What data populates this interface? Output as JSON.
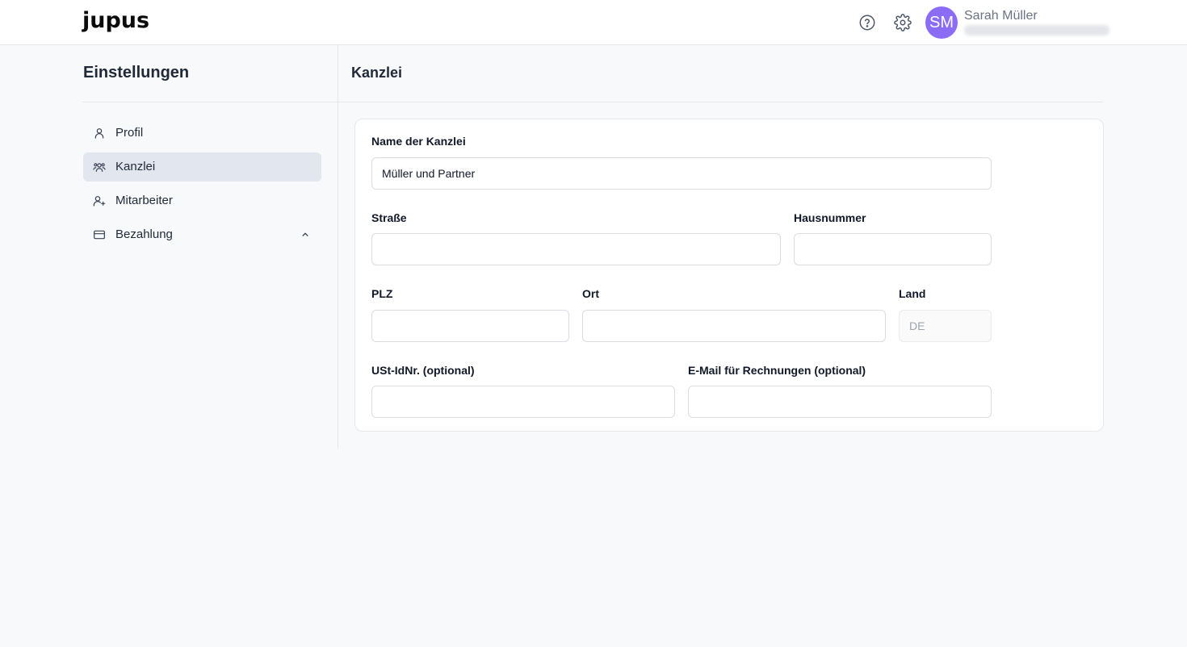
{
  "header": {
    "logo": "jupus",
    "user": {
      "initials": "SM",
      "name": "Sarah Müller",
      "avatar_color": "#8b6cf6"
    },
    "icons": [
      "help-icon",
      "gear-icon"
    ]
  },
  "sidebar": {
    "title": "Einstellungen",
    "items": [
      {
        "label": "Profil",
        "icon": "user-icon",
        "active": false
      },
      {
        "label": "Kanzlei",
        "icon": "users-icon",
        "active": true
      },
      {
        "label": "Mitarbeiter",
        "icon": "user-plus-icon",
        "active": false
      },
      {
        "label": "Bezahlung",
        "icon": "credit-card-icon",
        "active": false,
        "expand_icon": "chevron-up-icon"
      }
    ]
  },
  "main": {
    "title": "Kanzlei",
    "form": {
      "name": {
        "label": "Name der Kanzlei",
        "value": "Müller und Partner"
      },
      "street": {
        "label": "Straße",
        "value": ""
      },
      "house_number": {
        "label": "Hausnummer",
        "value": ""
      },
      "zip": {
        "label": "PLZ",
        "value": ""
      },
      "city": {
        "label": "Ort",
        "value": ""
      },
      "country": {
        "label": "Land",
        "placeholder": "DE",
        "value": ""
      },
      "vat_id": {
        "label": "USt-IdNr. (optional)",
        "value": ""
      },
      "invoice_email": {
        "label": "E-Mail für Rechnungen (optional)",
        "value": ""
      }
    }
  },
  "colors": {
    "accent": "#8b6cf6",
    "active_nav_bg": "#e2e6ee",
    "page_bg": "#f8f9fb"
  }
}
